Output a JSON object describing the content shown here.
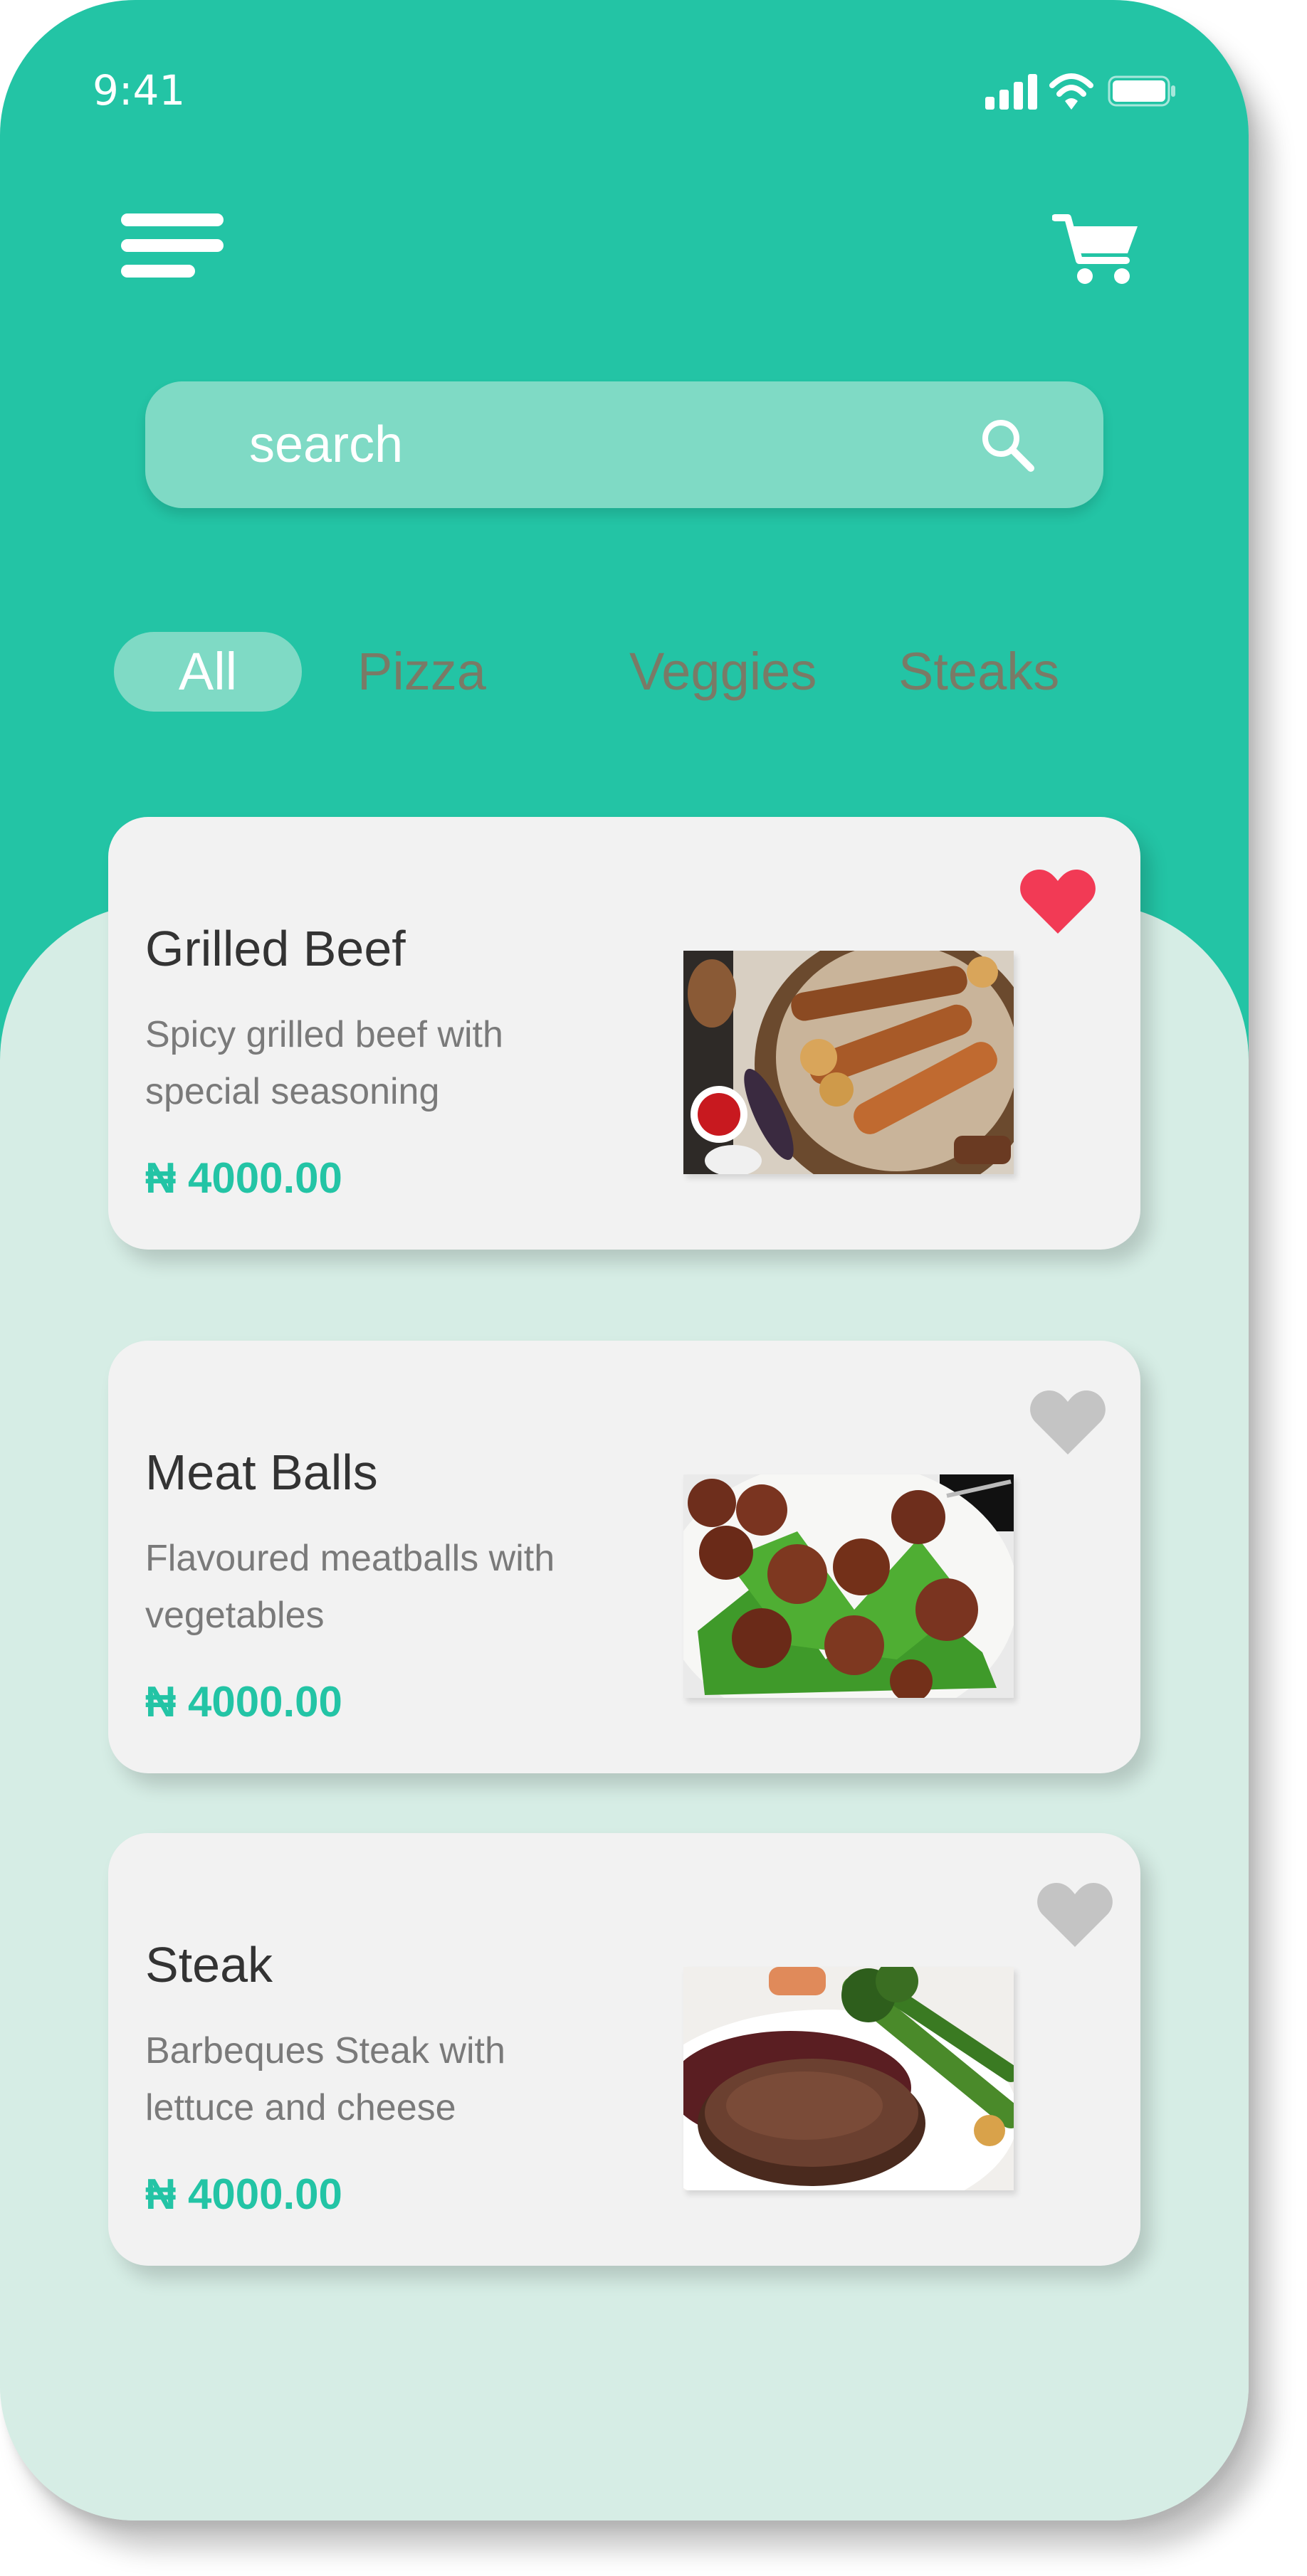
{
  "status_bar": {
    "time": "9:41",
    "signal_icon": "cellular-signal-icon",
    "wifi_icon": "wifi-icon",
    "battery_icon": "battery-icon"
  },
  "top_nav": {
    "menu_icon": "hamburger-menu-icon",
    "cart_icon": "shopping-cart-icon"
  },
  "search": {
    "placeholder": "search",
    "icon": "search-icon"
  },
  "categories": {
    "selected": "All",
    "tabs": [
      {
        "label": "All"
      },
      {
        "label": "Pizza"
      },
      {
        "label": "Veggies"
      },
      {
        "label": "Steaks"
      }
    ]
  },
  "menu_items": [
    {
      "title": "Grilled Beef",
      "description": "Spicy grilled beef with special seasoning",
      "price": "₦ 4000.00",
      "favorite": true,
      "image": "grilled-beef-photo"
    },
    {
      "title": "Meat Balls",
      "description": "Flavoured meatballs with vegetables",
      "price": "₦ 4000.00",
      "favorite": false,
      "image": "meatballs-photo"
    },
    {
      "title": "Steak",
      "description": "Barbeques Steak with lettuce and cheese",
      "price": "₦ 4000.00",
      "favorite": false,
      "image": "steak-photo"
    }
  ],
  "colors": {
    "brand": "#23c4a5",
    "search_fill": "#7fdac5",
    "content_background": "#d6ede5",
    "card_background": "#f2f2f2",
    "favorite_active": "#f23a55",
    "favorite_inactive": "#c4c4c4",
    "tab_inactive_text": "#7a7a66",
    "title_text": "#333333",
    "description_text": "#7a7a7a"
  }
}
